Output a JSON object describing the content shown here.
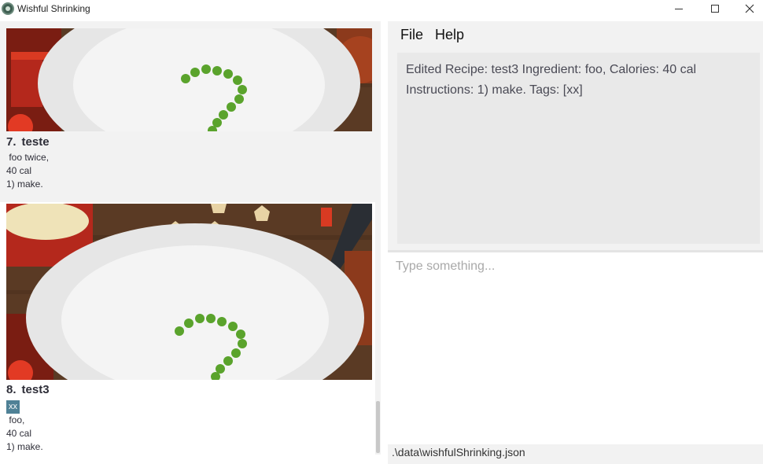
{
  "window": {
    "title": "Wishful Shrinking"
  },
  "menu": {
    "file": "File",
    "help": "Help"
  },
  "recipes": [
    {
      "index": "7.",
      "name": "teste",
      "tags": [],
      "ingredients": " foo twice,",
      "calories": "40 cal",
      "instructions": "1) make."
    },
    {
      "index": "8.",
      "name": "test3",
      "tags": [
        "xx"
      ],
      "ingredients": " foo,",
      "calories": "40 cal",
      "instructions": "1) make."
    }
  ],
  "result": {
    "message": "Edited Recipe: test3 Ingredient:  foo,  Calories: 40 cal Instructions: 1) make. Tags: [xx]"
  },
  "command": {
    "placeholder": "Type something...",
    "value": ""
  },
  "status": {
    "path": ".\\data\\wishfulShrinking.json"
  },
  "colors": {
    "tag_bg": "#4f8196",
    "panel_bg": "#f2f2f2",
    "result_bg": "#e9e9e9"
  },
  "icons": {
    "app": "app-logo-icon",
    "minimize": "minimize-icon",
    "maximize": "maximize-icon",
    "close": "close-icon"
  }
}
